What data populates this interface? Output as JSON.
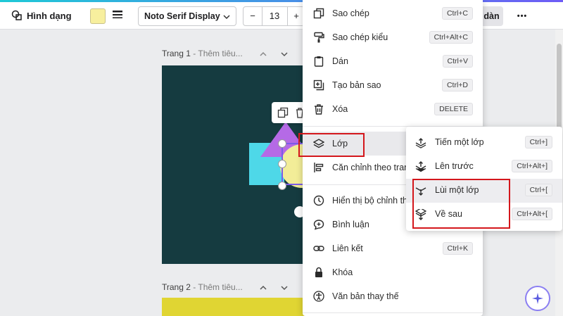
{
  "toolbar": {
    "shape_label": "Hình dạng",
    "font_name": "Noto Serif Display",
    "font_size": "13",
    "minus": "−",
    "plus": "+",
    "right_button": "dàn",
    "more": "•••",
    "fill_color": "#f7ef9e"
  },
  "pages": [
    {
      "title": "Trang 1",
      "subtitle": " - Thêm tiêu..."
    },
    {
      "title": "Trang 2",
      "subtitle": " - Thêm tiêu..."
    }
  ],
  "context_menu": {
    "items": [
      {
        "label": "Sao chép",
        "shortcut": "Ctrl+C",
        "icon": "copy-icon"
      },
      {
        "label": "Sao chép kiểu",
        "shortcut": "Ctrl+Alt+C",
        "icon": "paint-roller-icon"
      },
      {
        "label": "Dán",
        "shortcut": "Ctrl+V",
        "icon": "clipboard-icon"
      },
      {
        "label": "Tạo bản sao",
        "shortcut": "Ctrl+D",
        "icon": "duplicate-icon"
      },
      {
        "label": "Xóa",
        "shortcut": "DELETE",
        "icon": "trash-icon"
      },
      {
        "label": "Lớp",
        "shortcut": "",
        "icon": "layers-icon"
      },
      {
        "label": "Căn chỉnh theo trang",
        "shortcut": "",
        "icon": "align-icon"
      },
      {
        "label": "Hiển thị bộ chỉnh thời gian",
        "shortcut": "",
        "icon": "clock-icon"
      },
      {
        "label": "Bình luận",
        "shortcut": "",
        "icon": "comment-icon"
      },
      {
        "label": "Liên kết",
        "shortcut": "Ctrl+K",
        "icon": "link-icon"
      },
      {
        "label": "Khóa",
        "shortcut": "",
        "icon": "lock-icon"
      },
      {
        "label": "Văn bản thay thế",
        "shortcut": "",
        "icon": "accessibility-icon"
      }
    ]
  },
  "submenu": {
    "items": [
      {
        "label": "Tiến một lớp",
        "shortcut": "Ctrl+]",
        "icon": "bring-forward-icon"
      },
      {
        "label": "Lên trước",
        "shortcut": "Ctrl+Alt+]",
        "icon": "bring-to-front-icon"
      },
      {
        "label": "Lùi một lớp",
        "shortcut": "Ctrl+[",
        "icon": "send-backward-icon"
      },
      {
        "label": "Về sau",
        "shortcut": "Ctrl+Alt+[",
        "icon": "send-to-back-icon"
      }
    ]
  },
  "colors": {
    "slide1_bg": "#153b40",
    "slide2_bg": "#e0d533",
    "highlight": "#d4171c",
    "accent": "#8b7ff2"
  }
}
